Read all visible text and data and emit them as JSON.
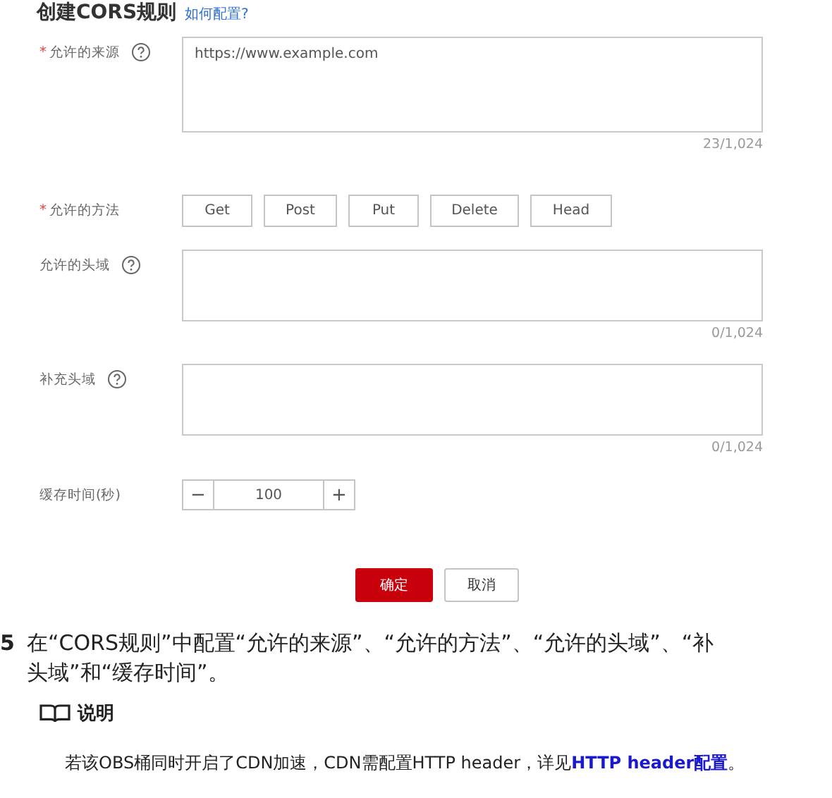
{
  "title": {
    "text": "创建CORS规则",
    "link": "如何配置?"
  },
  "fields": [
    {
      "kind": "textarea",
      "label": "允许的来源",
      "mark": "*",
      "help": true,
      "value": "https://www.example.com",
      "counter": "23/1,024"
    },
    {
      "kind": "methods",
      "label": "允许的方法",
      "mark": "*",
      "help": false,
      "methods": [
        {
          "label": "Get",
          "selected": false
        },
        {
          "label": "Post",
          "selected": false
        },
        {
          "label": "Put",
          "selected": false
        },
        {
          "label": "Delete",
          "selected": false
        },
        {
          "label": "Head",
          "selected": false
        }
      ]
    },
    {
      "kind": "textarea",
      "label": "允许的头域",
      "help": true,
      "counter": "0/1,024"
    },
    {
      "kind": "textarea",
      "label": "补充头域",
      "help": true,
      "counter": "0/1,024"
    },
    {
      "kind": "stepper",
      "label": "缓存时间(秒)",
      "help": false,
      "minus": "−",
      "value": "100",
      "plus": "+"
    }
  ],
  "buttons": [
    {
      "label": "确定",
      "kind": "primary"
    },
    {
      "label": "取消",
      "kind": "default"
    }
  ],
  "step": {
    "number": "5",
    "lines": [
      "在“CORS规则”中配置“允许的来源”、“允许的方法”、“允许的头域”、“补",
      "头域”和“缓存时间”。"
    ]
  },
  "note": {
    "title": "说明",
    "text": "若该OBS桶同时开启了CDN加速，CDN需配置HTTP header，详见",
    "link": "HTTP header配置",
    "end": "。"
  }
}
